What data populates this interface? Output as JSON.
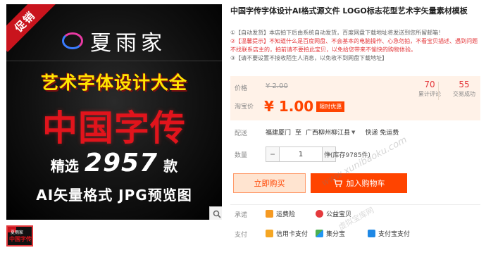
{
  "colors": {
    "accent": "#ff4400",
    "price_red": "#e4393c",
    "price_box_bg": "#fff2e8",
    "promo_red": "#c9141d",
    "poster_yellow": "#ffe600"
  },
  "gallery": {
    "promo_ribbon": "促销",
    "brand_name": "夏雨家",
    "line_yellow": "艺术字体设计大全",
    "line_red": "中国字传",
    "count_prefix": "精选",
    "count_number": "2957",
    "count_suffix": "款",
    "format_line": "AI矢量格式  JPG预览图",
    "zoom_icon": "magnifier-icon",
    "thumb_brand": "夏雨家",
    "thumb_text": "中国字传"
  },
  "product": {
    "title": "中国字传字体设计AI格式源文件 LOGO标志花型艺术字矢量素材模板",
    "notes": [
      "①【自动发货】本店拍下后由系统自动发货，百度网盘下载地址将发送到您所留邮箱！",
      "②【温馨提示】不知道什么是百度网盘、不会基本的电脑操作、心急勿拍，不看宝贝描述、遇到问题不找联系店主的，拍前请不要拍此宝贝，以免给您带来不愉快的购物体验。",
      "③【请不要设置不接收陌生人消息，以免收不到网盘下载地址】"
    ]
  },
  "price": {
    "orig_label": "价格",
    "orig_value": "¥ 2.00",
    "promo_label": "淘宝价",
    "promo_value": "¥ 1.00",
    "badge": "限时优惠",
    "reviews_count": "70",
    "reviews_label": "累计评论",
    "sales_count": "55",
    "sales_label": "交易成功"
  },
  "shipping": {
    "label": "配送",
    "from": "福建厦门",
    "to_prefix": "至",
    "destination": "广西柳州柳江县",
    "method": "快递 免运费"
  },
  "quantity": {
    "label": "数量",
    "minus": "−",
    "value": "1",
    "plus": "+",
    "stock": "件(库存9785件)"
  },
  "actions": {
    "buy_now": "立即购买",
    "add_cart": "加入购物车"
  },
  "services": {
    "promise_label": "承诺",
    "promise_items": [
      "运费险",
      "公益宝贝"
    ],
    "pay_label": "支付",
    "pay_items": [
      "信用卡支付",
      "集分宝",
      "支付宝支付"
    ]
  },
  "watermarks": [
    "www.xunibaoku.com",
    "虚拟宝库网"
  ]
}
